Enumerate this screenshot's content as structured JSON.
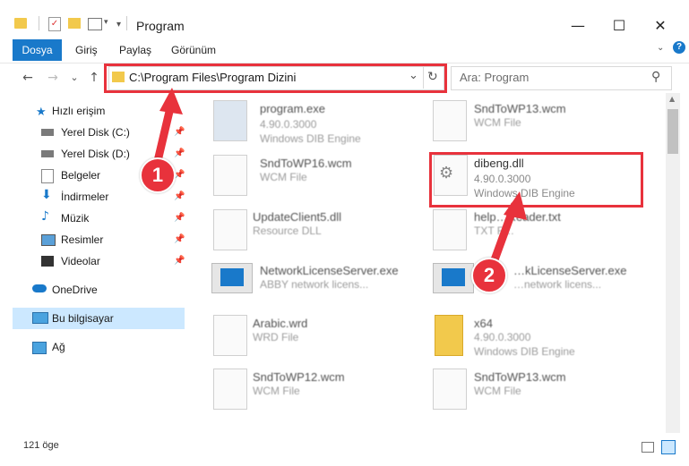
{
  "window": {
    "title": "Program",
    "minimize": "—",
    "maximize": "☐",
    "close": "✕",
    "help": "?"
  },
  "ribbon": {
    "tabs": [
      "Dosya",
      "Giriş",
      "Paylaş",
      "Görünüm"
    ]
  },
  "address": {
    "path": "C:\\Program Files\\Program Dizini",
    "refresh": "↻",
    "dropdown": "⌄"
  },
  "search": {
    "placeholder": "Ara: Program"
  },
  "nav": {
    "back": "←",
    "forward": "→",
    "recent": "⌄",
    "up": "↑"
  },
  "sidebar": {
    "quick_access": "Hızlı erişim",
    "items": [
      "Yerel Disk (C:)",
      "Yerel Disk (D:)",
      "Belgeler",
      "İndirmeler",
      "Müzik",
      "Resimler",
      "Videolar"
    ],
    "onedrive": "OneDrive",
    "this_pc": "Bu bilgisayar",
    "network": "Ağ"
  },
  "files": [
    {
      "name": "program.exe",
      "line1": "4.90.0.3000",
      "line2": "Windows DIB Engine"
    },
    {
      "name": "SndToWP13.wcm",
      "line1": "WCM File",
      "line2": ""
    },
    {
      "name": "SndToWP16.wcm",
      "line1": "WCM File",
      "line2": ""
    },
    {
      "name": "dibeng.dll",
      "line1": "4.90.0.3000",
      "line2": "Windows DIB Engine"
    },
    {
      "name": "UpdateClient5.dll",
      "line1": "Resource DLL",
      "line2": ""
    },
    {
      "name": "help…Reader.txt",
      "line1": "TXT F…",
      "line2": ""
    },
    {
      "name": "NetworkLicenseServer.exe",
      "line1": "ABBY network licens...",
      "line2": ""
    },
    {
      "name": "…kLicenseServer.exe",
      "line1": "…network licens...",
      "line2": ""
    },
    {
      "name": "Arabic.wrd",
      "line1": "WRD File",
      "line2": ""
    },
    {
      "name": "x64",
      "line1": "4.90.0.3000",
      "line2": "Windows DIB Engine"
    },
    {
      "name": "SndToWP12.wcm",
      "line1": "WCM File",
      "line2": ""
    },
    {
      "name": "SndToWP13.wcm",
      "line1": "WCM File",
      "line2": ""
    }
  ],
  "status": {
    "count": "121 öge"
  },
  "annotations": {
    "badge1": "1",
    "badge2": "2"
  },
  "colors": {
    "accent": "#1979ca",
    "highlight": "#e8323c",
    "selection": "#cce8ff"
  }
}
